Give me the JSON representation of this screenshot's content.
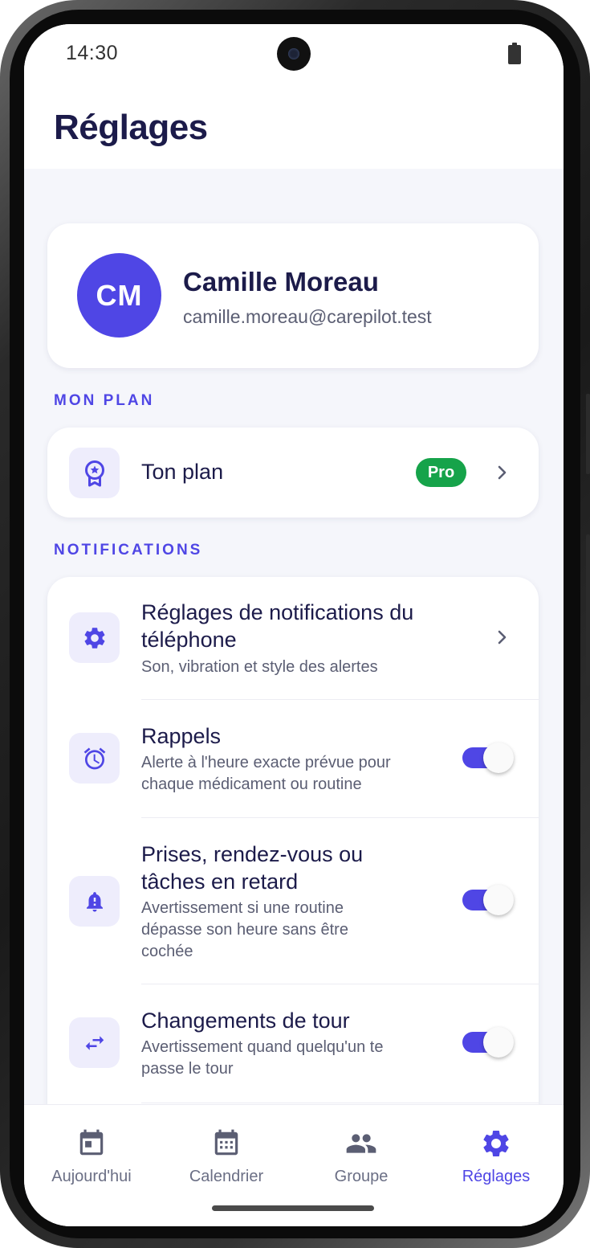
{
  "status_bar": {
    "time": "14:30"
  },
  "header": {
    "title": "Réglages"
  },
  "profile": {
    "initials": "CM",
    "name": "Camille Moreau",
    "email": "camille.moreau@carepilot.test",
    "avatar_color": "#4f46e5"
  },
  "plan_section": {
    "label": "MON PLAN",
    "item_label": "Ton plan",
    "badge": "Pro",
    "badge_color": "#16a34a",
    "icon": "award-icon"
  },
  "notifications_section": {
    "label": "NOTIFICATIONS",
    "items": [
      {
        "icon": "gear-icon",
        "title_line1": "Réglages de notifications du",
        "title_line2": "téléphone",
        "sub_line1": "Son, vibration et style des alertes",
        "type": "chevron"
      },
      {
        "icon": "alarm-clock-icon",
        "title_line1": "Rappels",
        "sub_line1": "Alerte à l'heure exacte prévue pour",
        "sub_line2": "chaque médicament ou routine",
        "type": "toggle",
        "enabled": true
      },
      {
        "icon": "bell-alert-icon",
        "title_line1": "Prises, rendez-vous ou",
        "title_line2": "tâches en retard",
        "sub_line1": "Avertissement si une routine",
        "sub_line2": "dépasse son heure sans être",
        "sub_line3": "cochée",
        "type": "toggle",
        "enabled": true
      },
      {
        "icon": "swap-arrows-icon",
        "title_line1": "Changements de tour",
        "sub_line1": "Avertissement quand quelqu'un te",
        "sub_line2": "passe le tour",
        "type": "toggle",
        "enabled": true
      }
    ]
  },
  "bottom_nav": {
    "items": [
      {
        "label": "Aujourd'hui",
        "icon": "calendar-today-icon",
        "active": false
      },
      {
        "label": "Calendrier",
        "icon": "calendar-month-icon",
        "active": false
      },
      {
        "label": "Groupe",
        "icon": "group-icon",
        "active": false
      },
      {
        "label": "Réglages",
        "icon": "gear-icon",
        "active": true
      }
    ]
  },
  "colors": {
    "accent": "#4f46e5",
    "text_primary": "#1c1b4a",
    "text_secondary": "#5b5e73",
    "background": "#f5f6fb"
  }
}
